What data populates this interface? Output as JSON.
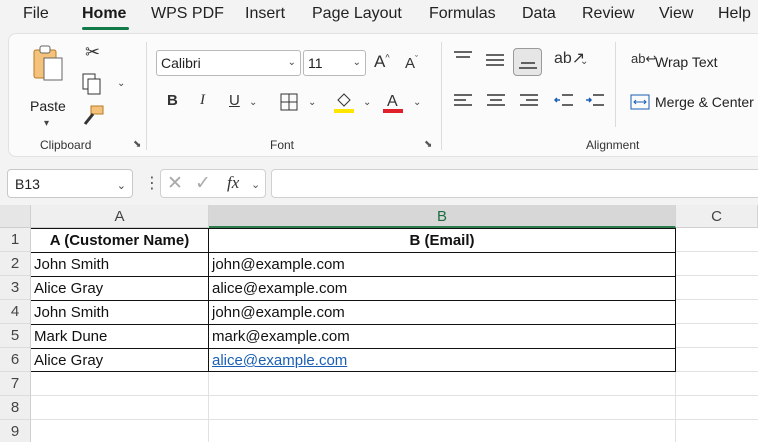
{
  "menu": {
    "items": [
      "File",
      "Home",
      "WPS PDF",
      "Insert",
      "Page Layout",
      "Formulas",
      "Data",
      "Review",
      "View",
      "Help"
    ],
    "active": "Home"
  },
  "ribbon": {
    "clipboard": {
      "paste_label": "Paste",
      "group_label": "Clipboard"
    },
    "font": {
      "font_name": "Calibri",
      "font_size": "11",
      "bold": "B",
      "italic": "I",
      "underline": "U",
      "group_label": "Font"
    },
    "alignment": {
      "wrap_text": "Wrap Text",
      "merge_center": "Merge & Center",
      "group_label": "Alignment"
    }
  },
  "formula_bar": {
    "name_box": "B13",
    "formula": "",
    "fx": "fx"
  },
  "sheet": {
    "columns": [
      "A",
      "B",
      "C"
    ],
    "selected_column": "B",
    "row_numbers": [
      "1",
      "2",
      "3",
      "4",
      "5",
      "6",
      "7",
      "8",
      "9"
    ],
    "header": [
      "A (Customer Name)",
      "B (Email)"
    ],
    "rows": [
      [
        "John Smith",
        "john@example.com"
      ],
      [
        "Alice Gray",
        "alice@example.com"
      ],
      [
        "John Smith",
        "john@example.com"
      ],
      [
        "Mark Dune",
        "mark@example.com"
      ],
      [
        "Alice Gray",
        "alice@example.com"
      ]
    ],
    "hyperlink_color": "#1a5fb4",
    "accent_color": "#117a48"
  }
}
